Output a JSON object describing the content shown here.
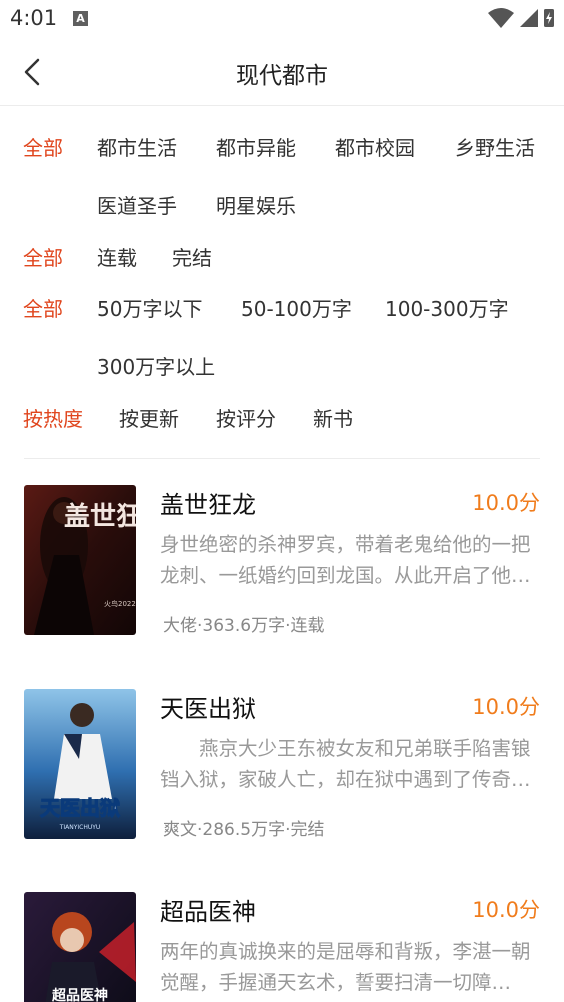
{
  "status_bar": {
    "time": "4:01",
    "a_badge": "A"
  },
  "header": {
    "title": "现代都市",
    "back_icon": "chevron-left-icon"
  },
  "filters": {
    "category": {
      "all": "全部",
      "options": [
        "都市生活",
        "都市异能",
        "都市校园",
        "乡野生活",
        "医道圣手",
        "明星娱乐"
      ]
    },
    "status": {
      "all": "全部",
      "options": [
        "连载",
        "完结"
      ]
    },
    "word_count": {
      "all": "全部",
      "options": [
        "50万字以下",
        "50-100万字",
        "100-300万字",
        "300万字以上"
      ]
    },
    "sort": {
      "options": [
        "按热度",
        "按更新",
        "按评分",
        "新书"
      ],
      "selected": "按热度"
    }
  },
  "books": [
    {
      "title": "盖世狂龙",
      "score": "10.0分",
      "desc": "身世绝密的杀神罗宾，带着老鬼给他的一把龙刺、一纸婚约回到龙国。从此开启了他的传奇人生……",
      "meta": "大佬·363.6万字·连载",
      "cover_text": "盖世狂龙",
      "cover_caption": "火鸟2022"
    },
    {
      "title": "天医出狱",
      "score": "10.0分",
      "desc": "　　燕京大少王东被女友和兄弟联手陷害锒铛入狱，家破人亡，却在狱中遇到了传奇人物……",
      "meta": "爽文·286.5万字·完结",
      "cover_text": "天医出狱",
      "cover_caption": "TIANYICHUYU"
    },
    {
      "title": "超品医神",
      "score": "10.0分",
      "desc": "两年的真诚换来的是屈辱和背叛，李湛一朝觉醒，手握通天玄术，誓要扫清一切障碍……",
      "meta": "",
      "cover_text": "超品医神",
      "cover_caption": ""
    }
  ],
  "colors": {
    "accent": "#e0461e",
    "score": "#f07c1c",
    "muted": "#999999"
  }
}
